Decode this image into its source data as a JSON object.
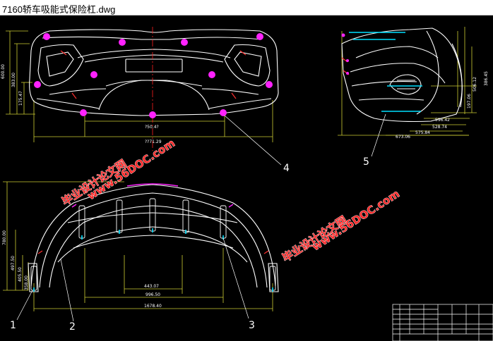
{
  "window": {
    "title": "7160轿车吸能式保险杠.dwg"
  },
  "drawing": {
    "callouts": {
      "c1": "1",
      "c2": "2",
      "c3": "3",
      "c4": "4",
      "c5": "5"
    },
    "front_view_dims": {
      "overall_height": "600.00",
      "height_2": "383.00",
      "height_3": "175.47",
      "width_inner": "?50.4?",
      "width_overall": "??71.29"
    },
    "side_view_dims": {
      "height_1": "506.12",
      "height_2": "386.45",
      "height_3": "197.06",
      "d1": "596.42",
      "d2": "528.74",
      "d3": "575.84",
      "d4": "673.06"
    },
    "top_view_dims": {
      "overall_depth": "780.00",
      "d2": "497.50",
      "d3": "405.50",
      "d4": "358.00",
      "w1": "443.07",
      "w2": "996.50",
      "w3": "1678.40"
    },
    "watermark": {
      "cn_text": "毕业设计论文网",
      "url_text": "www.56DOC.com"
    }
  }
}
